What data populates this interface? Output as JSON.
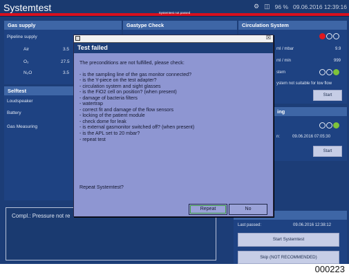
{
  "header": {
    "title": "Systemtest",
    "alert": "Systemtest not passed",
    "battery": "96 %",
    "datetime": "09.06.2016  12:39:16"
  },
  "gas_supply": {
    "title": "Gas supply",
    "subtitle": "Pipeline supply",
    "rows": [
      {
        "label": "Air",
        "value": "3.5"
      },
      {
        "label": "O₂",
        "value": "27.5"
      },
      {
        "label": "N₂O",
        "value": "3.5"
      }
    ]
  },
  "gastype": {
    "title": "Gastype Check"
  },
  "selftest": {
    "title": "Selftest",
    "items": [
      "Loudspeaker",
      "Battery",
      "Gas Measuring"
    ]
  },
  "circulation": {
    "title": "Circulation System",
    "row1_unit": "ml / mbar",
    "row1_value": "9.9",
    "row2_unit": "ml / min",
    "row2_value": "999",
    "row3_label": "stem",
    "note": "ystem not suitable for low flow",
    "start_label": "Start"
  },
  "leak": {
    "title": "ing",
    "passed_label": "n:",
    "passed_value": "09.06.2016  07:05:30",
    "start_label": "Start"
  },
  "systemtest_panel": {
    "last_passed_label": "Last passed:",
    "last_passed_value": "09.06.2016  12:38:12",
    "start_label": "Start Systemtest",
    "skip_label": "Skip (NOT RECOMMENDED)"
  },
  "compl_text": "Compl.: Pressure not re",
  "dialog": {
    "title": "Test failed",
    "intro": "The preconditions are not fulfilled, please check:",
    "items": [
      "- is the sampling line of the gas monitor connected?",
      "- is the Y-piece on the test adapter?",
      "- circulation system and sight glasses",
      "- is the FiO2 cell on position? (when present)",
      "- damage of bacteria filters",
      "- watertrap",
      "- correct fit and damage of the flow sensors",
      "- locking of the patient module",
      "- check dome for leak",
      "- is external gasmonitor switched off? (when present)",
      "- is the APL set to 20 mbar?",
      "- repeat test"
    ],
    "question": "Repeat Systemtest?",
    "repeat_label": "Repeat",
    "no_label": "No"
  },
  "image_code": "000223"
}
